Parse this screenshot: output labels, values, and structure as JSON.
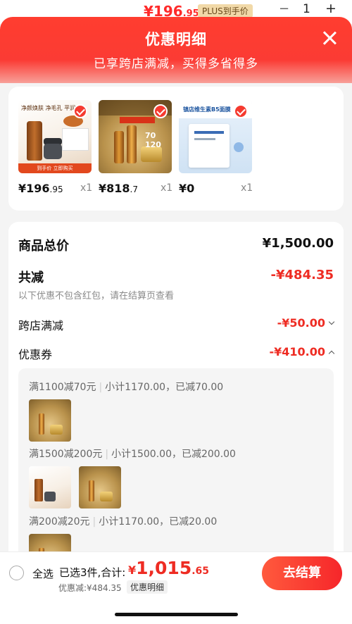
{
  "background_item": {
    "price_main": "¥196",
    "price_dec": ".95",
    "plus_badge": "PLUS到手价",
    "minus": "−",
    "qty": "1",
    "plus": "+"
  },
  "header": {
    "title": "优惠明细",
    "subtitle": "已享跨店满减，买得多省得多"
  },
  "products": [
    {
      "price_main": "¥196",
      "price_dec": ".95",
      "qty": "x1",
      "thumb_text": "净颜焕肤 净毛孔 平润口",
      "thumb_bar": "到手价 立即购买"
    },
    {
      "price_main": "¥818",
      "price_dec": ".7",
      "qty": "x1",
      "thumb_text": "70 120"
    },
    {
      "price_main": "¥0",
      "price_dec": "",
      "qty": "x1",
      "thumb_text": "镇店维生素B5面膜"
    }
  ],
  "summary": {
    "total_label": "商品总价",
    "total_value": "¥1,500.00",
    "reduce_label": "共减",
    "reduce_value": "-¥484.35",
    "reduce_note": "以下优惠不包含红包，请在结算页查看",
    "cross_store_label": "跨店满减",
    "cross_store_value": "-¥50.00",
    "coupon_label": "优惠券",
    "coupon_value": "-¥410.00"
  },
  "coupon_tiers": [
    {
      "rule": "满1100减70元",
      "detail": "小计1170.00，已减70.00"
    },
    {
      "rule": "满1500减200元",
      "detail": "小计1500.00，已减200.00"
    },
    {
      "rule": "满200减20元",
      "detail": "小计1170.00，已减20.00"
    }
  ],
  "footer": {
    "select_all": "全选",
    "selected_count": "已选3件,合计:",
    "currency": "¥",
    "total_main": "1,015",
    "total_dec": ".65",
    "discount": "优惠减:¥484.35",
    "detail_link": "优惠明细",
    "checkout": "去结算"
  },
  "colors": {
    "accent": "#ee2c23",
    "header_red": "#ff3d2f"
  }
}
